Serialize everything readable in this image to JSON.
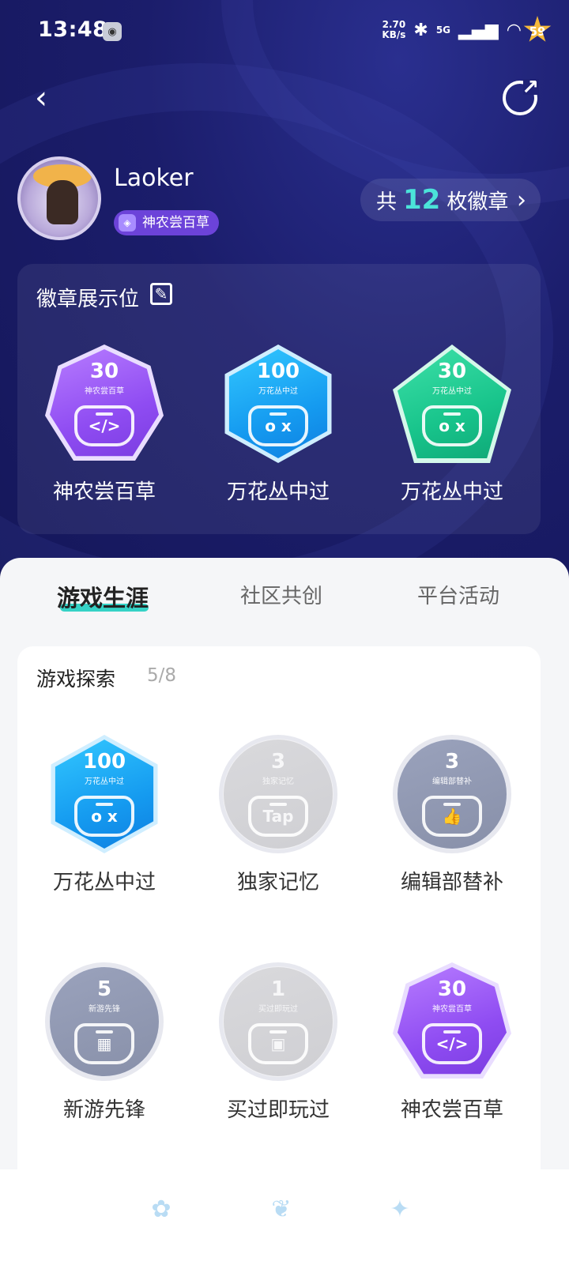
{
  "status": {
    "time": "13:48",
    "net_speed_value": "2.70",
    "net_speed_unit": "KB/s",
    "bluetooth_icon": "✱",
    "signal_label": "5G",
    "level_badge": "59"
  },
  "header": {
    "back_icon": "‹",
    "share_icon": "↗"
  },
  "profile": {
    "username": "Laoker",
    "title_chip": "神农尝百草",
    "badge_count_prefix": "共",
    "badge_count": "12",
    "badge_count_suffix": "枚徽章",
    "chevron": "›"
  },
  "showcase": {
    "title": "徽章展示位",
    "edit_icon": "✎",
    "items": [
      {
        "num": "30",
        "sub": "神农尝百草",
        "pad": "</>",
        "label": "神农尝百草",
        "color": "#8f4cf2"
      },
      {
        "num": "100",
        "sub": "万花丛中过",
        "pad": "o x",
        "label": "万花丛中过",
        "color": "#159bf0"
      },
      {
        "num": "30",
        "sub": "万花丛中过",
        "pad": "o x",
        "label": "万花丛中过",
        "color": "#18c48b"
      }
    ]
  },
  "tabs": [
    {
      "label": "游戏生涯",
      "active": true
    },
    {
      "label": "社区共创",
      "active": false
    },
    {
      "label": "平台活动",
      "active": false
    }
  ],
  "explore": {
    "title": "游戏探索",
    "progress": "5/8",
    "items": [
      {
        "num": "100",
        "sub": "万花丛中过",
        "pad": "o x",
        "label": "万花丛中过"
      },
      {
        "num": "3",
        "sub": "独家记忆",
        "pad": "Tap",
        "label": "独家记忆"
      },
      {
        "num": "3",
        "sub": "编辑部替补",
        "pad": "👍",
        "label": "编辑部替补"
      },
      {
        "num": "5",
        "sub": "新游先锋",
        "pad": "▦",
        "label": "新游先锋"
      },
      {
        "num": "1",
        "sub": "买过即玩过",
        "pad": "▣",
        "label": "买过即玩过"
      },
      {
        "num": "30",
        "sub": "神农尝百草",
        "pad": "</>",
        "label": "神农尝百草"
      }
    ]
  },
  "nav": {
    "icons": [
      "flower-icon",
      "leaf-icon",
      "sparkle-icon"
    ],
    "glyphs": [
      "✿",
      "❦",
      "✦"
    ]
  },
  "colors": {
    "header_bg": "#1b1d6b",
    "accent_teal": "#35d2c6",
    "count_teal": "#4be3d9",
    "chip_purple": "#6c43d9"
  }
}
